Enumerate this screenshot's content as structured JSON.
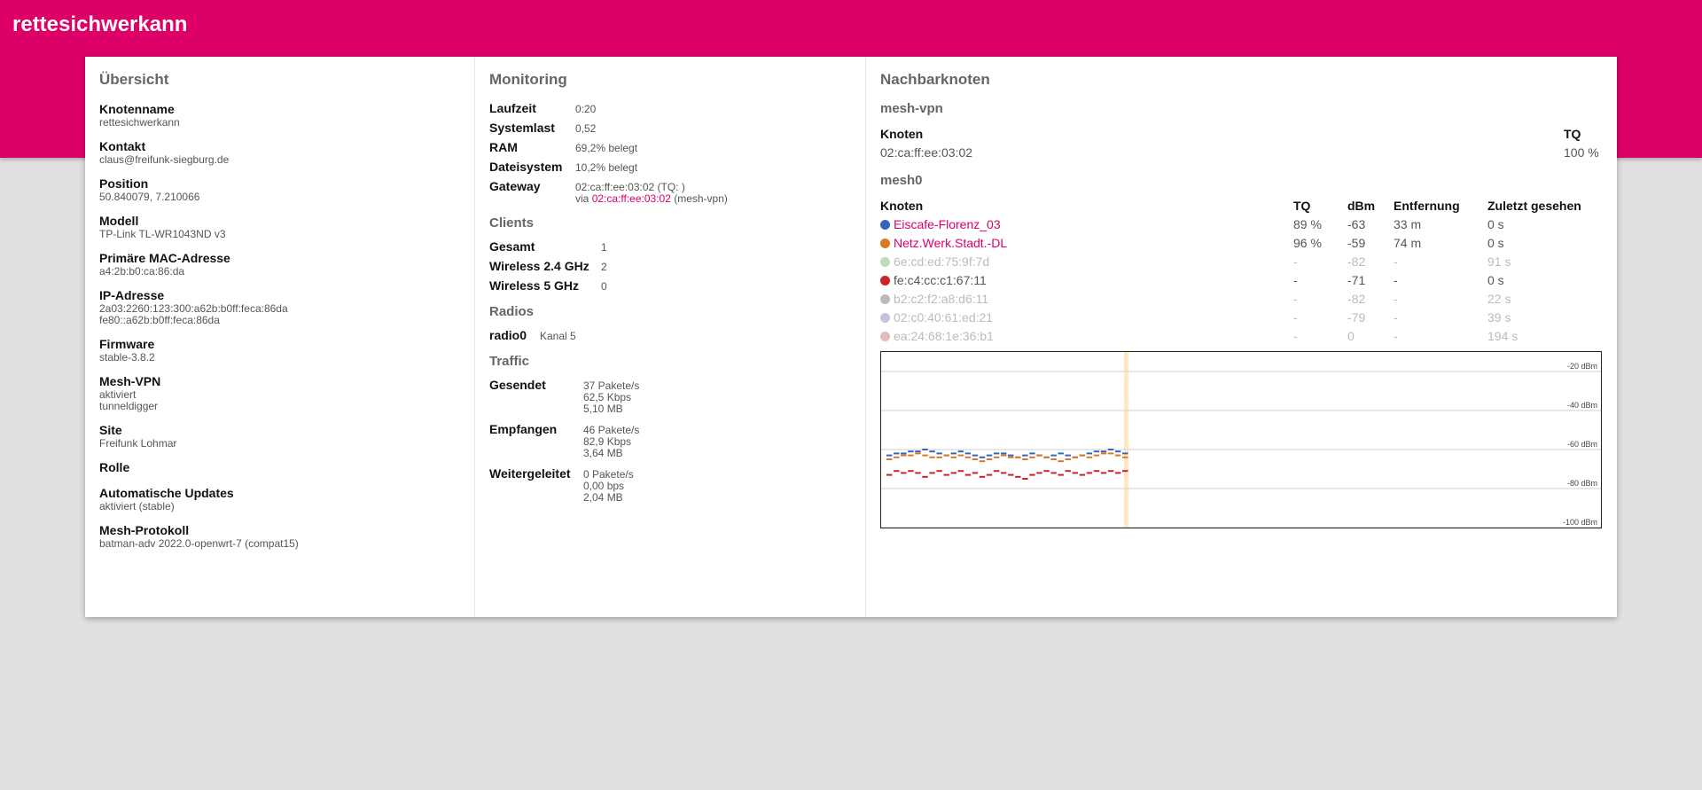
{
  "header": {
    "title": "rettesichwerkann"
  },
  "overview": {
    "heading": "Übersicht",
    "fields": [
      {
        "label": "Knotenname",
        "value": "rettesichwerkann"
      },
      {
        "label": "Kontakt",
        "value": "claus@freifunk-siegburg.de"
      },
      {
        "label": "Position",
        "value": "50.840079, 7.210066"
      },
      {
        "label": "Modell",
        "value": "TP-Link TL-WR1043ND v3"
      },
      {
        "label": "Primäre MAC-Adresse",
        "value": "a4:2b:b0:ca:86:da"
      },
      {
        "label": "IP-Adresse",
        "value": "2a03:2260:123:300:a62b:b0ff:feca:86da",
        "value2": "fe80::a62b:b0ff:feca:86da"
      },
      {
        "label": "Firmware",
        "value": "stable-3.8.2"
      },
      {
        "label": "Mesh-VPN",
        "value": "aktiviert",
        "value2": "tunneldigger"
      },
      {
        "label": "Site",
        "value": "Freifunk Lohmar"
      },
      {
        "label": "Rolle",
        "value": ""
      },
      {
        "label": "Automatische Updates",
        "value": "aktiviert (stable)"
      },
      {
        "label": "Mesh-Protokoll",
        "value": "batman-adv 2022.0-openwrt-7 (compat15)"
      }
    ]
  },
  "monitoring": {
    "heading": "Monitoring",
    "rows": [
      {
        "label": "Laufzeit",
        "value": "0:20"
      },
      {
        "label": "Systemlast",
        "value": "0,52"
      },
      {
        "label": "RAM",
        "value": "69,2% belegt"
      },
      {
        "label": "Dateisystem",
        "value": "10,2% belegt"
      }
    ],
    "gateway": {
      "label": "Gateway",
      "line1": "02:ca:ff:ee:03:02 (TQ: )",
      "via": "via",
      "link": "02:ca:ff:ee:03:02",
      "suffix": "(mesh-vpn)"
    },
    "clients": {
      "heading": "Clients",
      "rows": [
        {
          "label": "Gesamt",
          "value": "1"
        },
        {
          "label": "Wireless 2.4 GHz",
          "value": "2"
        },
        {
          "label": "Wireless 5 GHz",
          "value": "0"
        }
      ]
    },
    "radios": {
      "heading": "Radios",
      "rows": [
        {
          "label": "radio0",
          "value": "Kanal 5"
        }
      ]
    },
    "traffic": {
      "heading": "Traffic",
      "rows": [
        {
          "label": "Gesendet",
          "v1": "37 Pakete/s",
          "v2": "62,5 Kbps",
          "v3": "5,10 MB"
        },
        {
          "label": "Empfangen",
          "v1": "46 Pakete/s",
          "v2": "82,9 Kbps",
          "v3": "3,64 MB"
        },
        {
          "label": "Weitergeleitet",
          "v1": "0 Pakete/s",
          "v2": "0,00 bps",
          "v3": "2,04 MB"
        }
      ]
    }
  },
  "neighbors": {
    "heading": "Nachbarknoten",
    "vpn": {
      "heading": "mesh-vpn",
      "col_node": "Knoten",
      "col_tq": "TQ",
      "rows": [
        {
          "node": "02:ca:ff:ee:03:02",
          "tq": "100 %"
        }
      ]
    },
    "mesh0": {
      "heading": "mesh0",
      "columns": [
        "Knoten",
        "TQ",
        "dBm",
        "Entfernung",
        "Zuletzt gesehen"
      ],
      "rows": [
        {
          "node": "Eiscafe-Florenz_03",
          "tq": "89 %",
          "dbm": "-63",
          "dist": "33 m",
          "seen": "0 s",
          "color": "#3366bb",
          "link": true,
          "dim": false
        },
        {
          "node": "Netz.Werk.Stadt.-DL",
          "tq": "96 %",
          "dbm": "-59",
          "dist": "74 m",
          "seen": "0 s",
          "color": "#dd7722",
          "link": true,
          "dim": false
        },
        {
          "node": "6e:cd:ed:75:9f:7d",
          "tq": "-",
          "dbm": "-82",
          "dist": "-",
          "seen": "91 s",
          "color": "#bcdcbc",
          "link": false,
          "dim": true
        },
        {
          "node": "fe:c4:cc:c1:67:11",
          "tq": "-",
          "dbm": "-71",
          "dist": "-",
          "seen": "0 s",
          "color": "#cc2222",
          "link": false,
          "dim": false
        },
        {
          "node": "b2:c2:f2:a8:d6:11",
          "tq": "-",
          "dbm": "-82",
          "dist": "-",
          "seen": "22 s",
          "color": "#bbbbbb",
          "link": false,
          "dim": true
        },
        {
          "node": "02:c0:40:61:ed:21",
          "tq": "-",
          "dbm": "-79",
          "dist": "-",
          "seen": "39 s",
          "color": "#c4c4e0",
          "link": false,
          "dim": true
        },
        {
          "node": "ea:24:68:1e:36:b1",
          "tq": "-",
          "dbm": "0",
          "dist": "-",
          "seen": "194 s",
          "color": "#e0bcbc",
          "link": false,
          "dim": true
        }
      ]
    }
  },
  "chart_data": {
    "type": "line",
    "ylim": [
      -100,
      -10
    ],
    "yticks": [
      -20,
      -40,
      -60,
      -80,
      -100
    ],
    "tick_labels": [
      "-20 dBm",
      "-40 dBm",
      "-60 dBm",
      "-80 dBm",
      "-100 dBm"
    ],
    "series": [
      {
        "name": "Eiscafe-Florenz_03",
        "color": "#3366bb",
        "values": [
          -63,
          -62,
          -62,
          -61,
          -61,
          -60,
          -61,
          -62,
          -63,
          -62,
          -61,
          -62,
          -63,
          -64,
          -63,
          -62,
          -62,
          -63,
          -64,
          -63,
          -62,
          -63,
          -64,
          -63,
          -62,
          -63,
          -64,
          -63,
          -62,
          -61,
          -61,
          -60,
          -61,
          -62
        ]
      },
      {
        "name": "Netz.Werk.Stadt.-DL",
        "color": "#dd7722",
        "values": [
          -65,
          -64,
          -63,
          -63,
          -62,
          -63,
          -64,
          -64,
          -63,
          -64,
          -63,
          -64,
          -65,
          -66,
          -65,
          -64,
          -63,
          -64,
          -64,
          -65,
          -64,
          -63,
          -64,
          -65,
          -66,
          -65,
          -64,
          -63,
          -64,
          -63,
          -62,
          -62,
          -63,
          -64
        ]
      },
      {
        "name": "fe:c4:cc:c1:67:11",
        "color": "#cc2222",
        "values": [
          -73,
          -71,
          -72,
          -71,
          -72,
          -74,
          -72,
          -71,
          -73,
          -72,
          -71,
          -73,
          -72,
          -74,
          -73,
          -71,
          -72,
          -73,
          -74,
          -75,
          -73,
          -72,
          -71,
          -72,
          -73,
          -71,
          -72,
          -73,
          -72,
          -71,
          -72,
          -71,
          -72,
          -71
        ]
      }
    ]
  }
}
